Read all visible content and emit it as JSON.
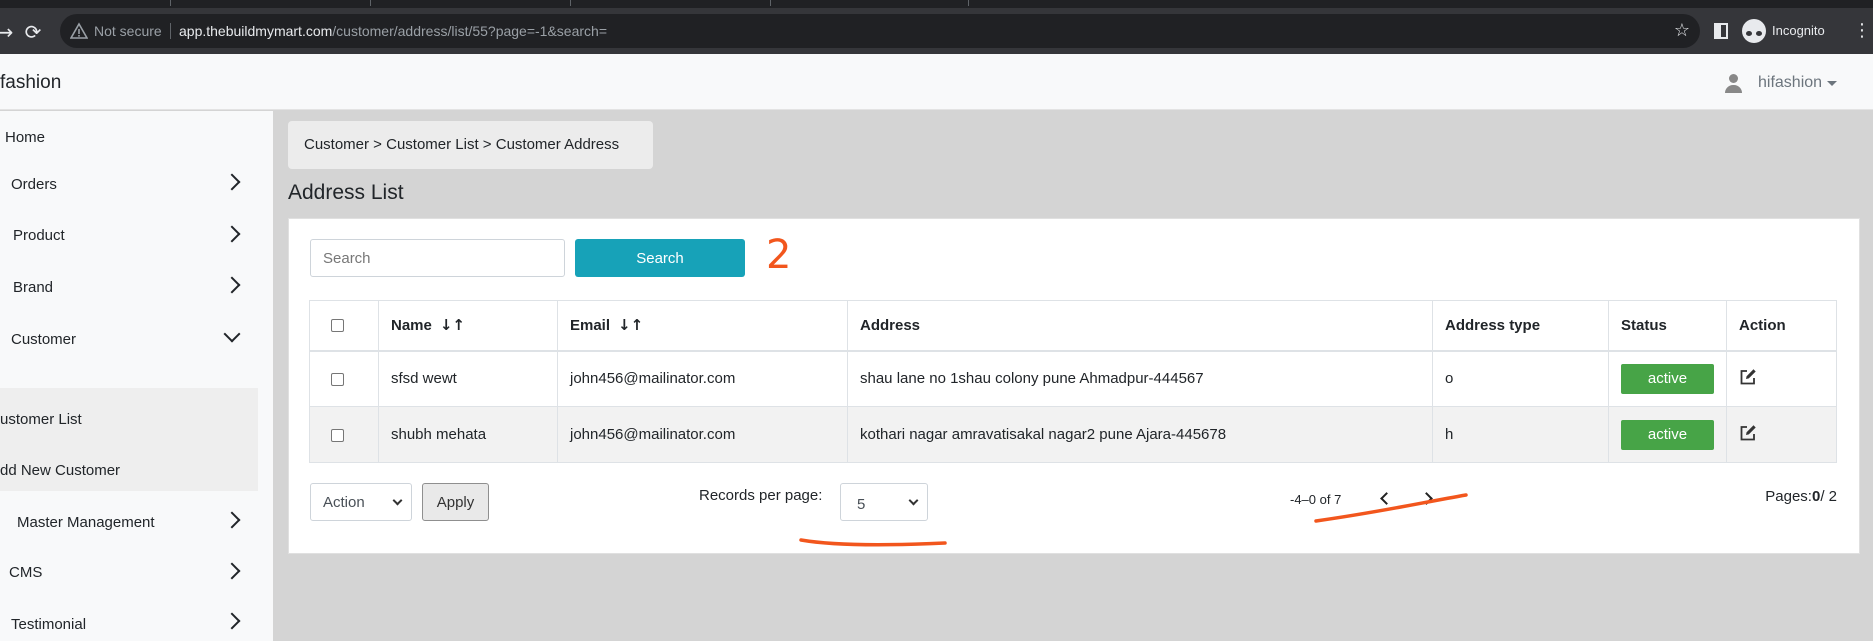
{
  "browser": {
    "security_label": "Not secure",
    "url_host": "app.thebuildmymart.com",
    "url_path": "/customer/address/list/55?page=-1&search=",
    "incognito_label": "Incognito"
  },
  "app": {
    "brand": "fashion",
    "user_name": "hifashion"
  },
  "sidebar": {
    "items": [
      {
        "label": "Home"
      },
      {
        "label": "Orders"
      },
      {
        "label": "Product"
      },
      {
        "label": "Brand"
      },
      {
        "label": "Customer"
      },
      {
        "label": "Master Management"
      },
      {
        "label": "CMS"
      },
      {
        "label": "Testimonial"
      }
    ],
    "customer_submenu": [
      {
        "label": "ustomer List"
      },
      {
        "label": "dd New Customer"
      }
    ]
  },
  "breadcrumb": "Customer > Customer List > Customer Address",
  "page_title": "Address List",
  "search": {
    "placeholder": "Search",
    "button_label": "Search"
  },
  "table": {
    "headers": {
      "name": "Name",
      "email": "Email",
      "address": "Address",
      "address_type": "Address type",
      "status": "Status",
      "action": "Action"
    },
    "sort_glyph": "↓↑",
    "rows": [
      {
        "name": "sfsd wewt",
        "email": "john456@mailinator.com",
        "address": "shau lane no 1shau colony pune Ahmadpur-444567",
        "address_type": "o",
        "status": "active"
      },
      {
        "name": "shubh mehata",
        "email": "john456@mailinator.com",
        "address": "kothari nagar amravatisakal nagar2 pune Ajara-445678",
        "address_type": "h",
        "status": "active"
      }
    ]
  },
  "footer": {
    "bulk_action_value": "Action",
    "apply_label": "Apply",
    "records_per_page_label": "Records per page:",
    "records_per_page_value": "5",
    "range_text": "-4–0 of 7",
    "pages_prefix": "Pages:",
    "current_page": "0",
    "pages_suffix": "/ 2"
  },
  "annotations": {
    "color": "#f2561d",
    "number": "2"
  }
}
